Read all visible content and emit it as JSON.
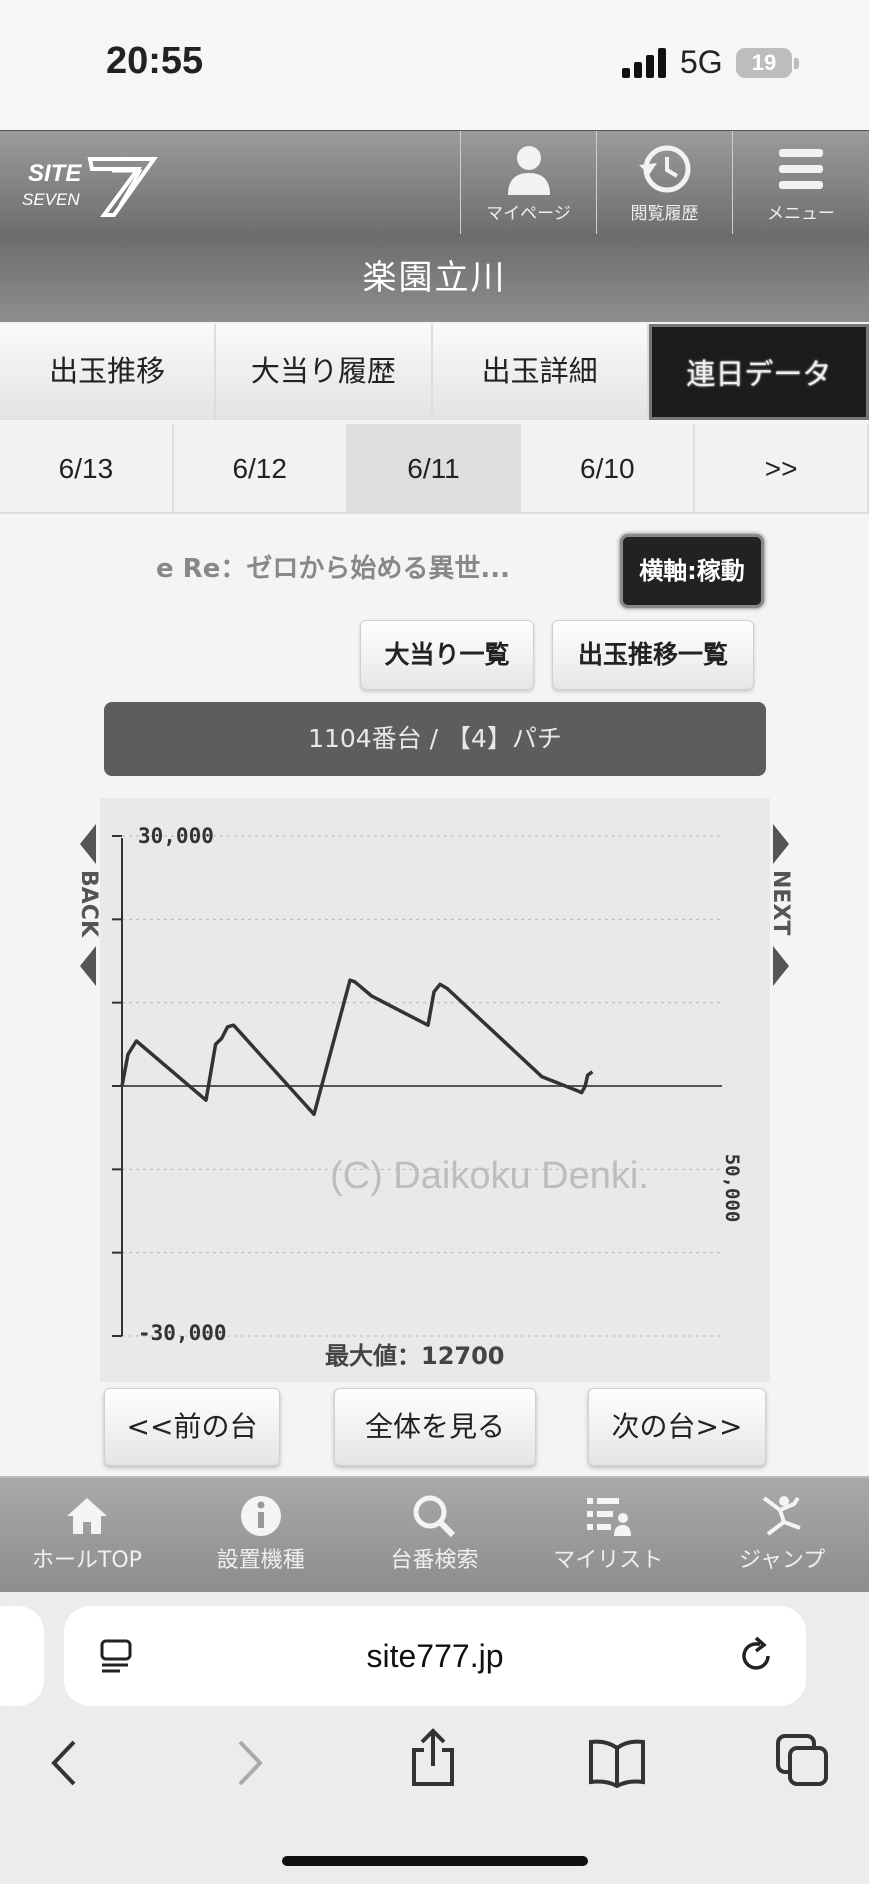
{
  "status": {
    "time": "20:55",
    "network": "5G",
    "battery": "19"
  },
  "header": {
    "logo": "SITE SEVEN",
    "buttons": [
      {
        "label": "マイページ",
        "icon": "person-icon"
      },
      {
        "label": "閲覧履歴",
        "icon": "history-icon"
      },
      {
        "label": "メニュー",
        "icon": "menu-icon"
      }
    ]
  },
  "hall_name": "楽園立川",
  "tabs": [
    "出玉推移",
    "大当り履歴",
    "出玉詳細",
    "連日データ"
  ],
  "active_tab": "連日データ",
  "dates": [
    "6/13",
    "6/12",
    "6/11",
    "6/10",
    ">>"
  ],
  "active_date": "6/11",
  "machine_name": "e Re：ゼロから始める異世...",
  "axis_toggle_label": "横軸:稼動",
  "jackpot_list_label": "大当り一覧",
  "payout_list_label": "出玉推移一覧",
  "machine_bar": "1104番台 / 【4】パチ",
  "chart": {
    "back_label": "BACK",
    "next_label": "NEXT",
    "watermark": "(C) Daikoku Denki.",
    "max_label": "最大値：12700",
    "x_max_label": "50,000",
    "ytick_top": "30,000",
    "ytick_bottom": "-30,000"
  },
  "chart_data": {
    "type": "line",
    "ylim": [
      -30000,
      30000
    ],
    "xlim": [
      0,
      50000
    ],
    "yticks": [
      30000,
      20000,
      10000,
      0,
      -10000,
      -20000,
      -30000
    ],
    "ytick_labels_shown": [
      "30,000",
      "-30,000"
    ],
    "x_max_label": "50,000",
    "grid": true,
    "series": [
      {
        "x": [
          0,
          500,
          1200,
          7000,
          7300,
          7800,
          8300,
          8800,
          9300,
          16000,
          19000,
          19400,
          20800,
          25500,
          26000,
          26500,
          27100,
          35000,
          38000,
          38300,
          38600,
          38800,
          39200
        ],
        "y": [
          0,
          3800,
          5400,
          -1700,
          800,
          5000,
          5700,
          7100,
          7300,
          -3400,
          12700,
          12500,
          10800,
          7300,
          11300,
          12200,
          11700,
          1100,
          -600,
          -800,
          0,
          1300,
          1700
        ]
      }
    ]
  },
  "bottom_buttons": {
    "prev": "<<前の台",
    "all": "全体を見る",
    "next": "次の台>>"
  },
  "bottom_nav": [
    {
      "label": "ホールTOP",
      "icon": "home-icon"
    },
    {
      "label": "設置機種",
      "icon": "info-icon"
    },
    {
      "label": "台番検索",
      "icon": "search-icon"
    },
    {
      "label": "マイリスト",
      "icon": "list-icon"
    },
    {
      "label": "ジャンプ",
      "icon": "jump-icon"
    }
  ],
  "browser": {
    "url": "site777.jp"
  }
}
